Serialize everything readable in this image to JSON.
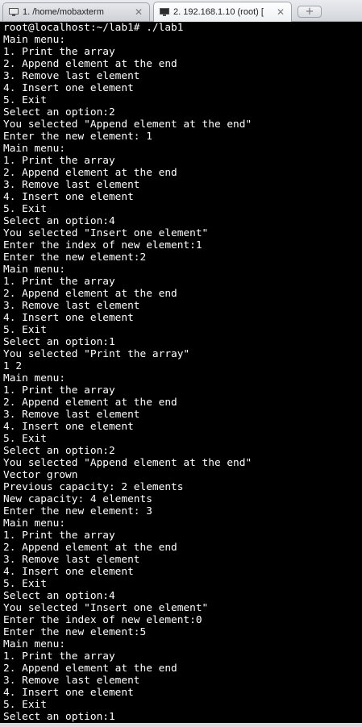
{
  "tabs": [
    {
      "label": "1. /home/mobaxterm",
      "close": "✕",
      "active": false
    },
    {
      "label": "2. 192.168.1.10 (root) [",
      "close": "✕",
      "active": true
    }
  ],
  "new_tab_label": "+",
  "terminal": {
    "lines": [
      "root@localhost:~/lab1# ./lab1",
      "Main menu:",
      "1. Print the array",
      "2. Append element at the end",
      "3. Remove last element",
      "4. Insert one element",
      "5. Exit",
      "Select an option:2",
      "You selected \"Append element at the end\"",
      "Enter the new element: 1",
      "Main menu:",
      "1. Print the array",
      "2. Append element at the end",
      "3. Remove last element",
      "4. Insert one element",
      "5. Exit",
      "Select an option:4",
      "You selected \"Insert one element\"",
      "Enter the index of new element:1",
      "Enter the new element:2",
      "Main menu:",
      "1. Print the array",
      "2. Append element at the end",
      "3. Remove last element",
      "4. Insert one element",
      "5. Exit",
      "Select an option:1",
      "You selected \"Print the array\"",
      "1 2",
      "Main menu:",
      "1. Print the array",
      "2. Append element at the end",
      "3. Remove last element",
      "4. Insert one element",
      "5. Exit",
      "Select an option:2",
      "You selected \"Append element at the end\"",
      "Vector grown",
      "Previous capacity: 2 elements",
      "New capacity: 4 elements",
      "Enter the new element: 3",
      "Main menu:",
      "1. Print the array",
      "2. Append element at the end",
      "3. Remove last element",
      "4. Insert one element",
      "5. Exit",
      "Select an option:4",
      "You selected \"Insert one element\"",
      "Enter the index of new element:0",
      "Enter the new element:5",
      "Main menu:",
      "1. Print the array",
      "2. Append element at the end",
      "3. Remove last element",
      "4. Insert one element",
      "5. Exit",
      "Select an option:1"
    ]
  },
  "colors": {
    "terminal_background": "#000000",
    "terminal_text": "#ffffff",
    "tabbar_background": "#d3d6db"
  },
  "icons": {
    "inactive_tab": "terminal-icon",
    "active_tab": "terminal-icon",
    "close": "close-icon",
    "new_tab": "plus-icon"
  }
}
